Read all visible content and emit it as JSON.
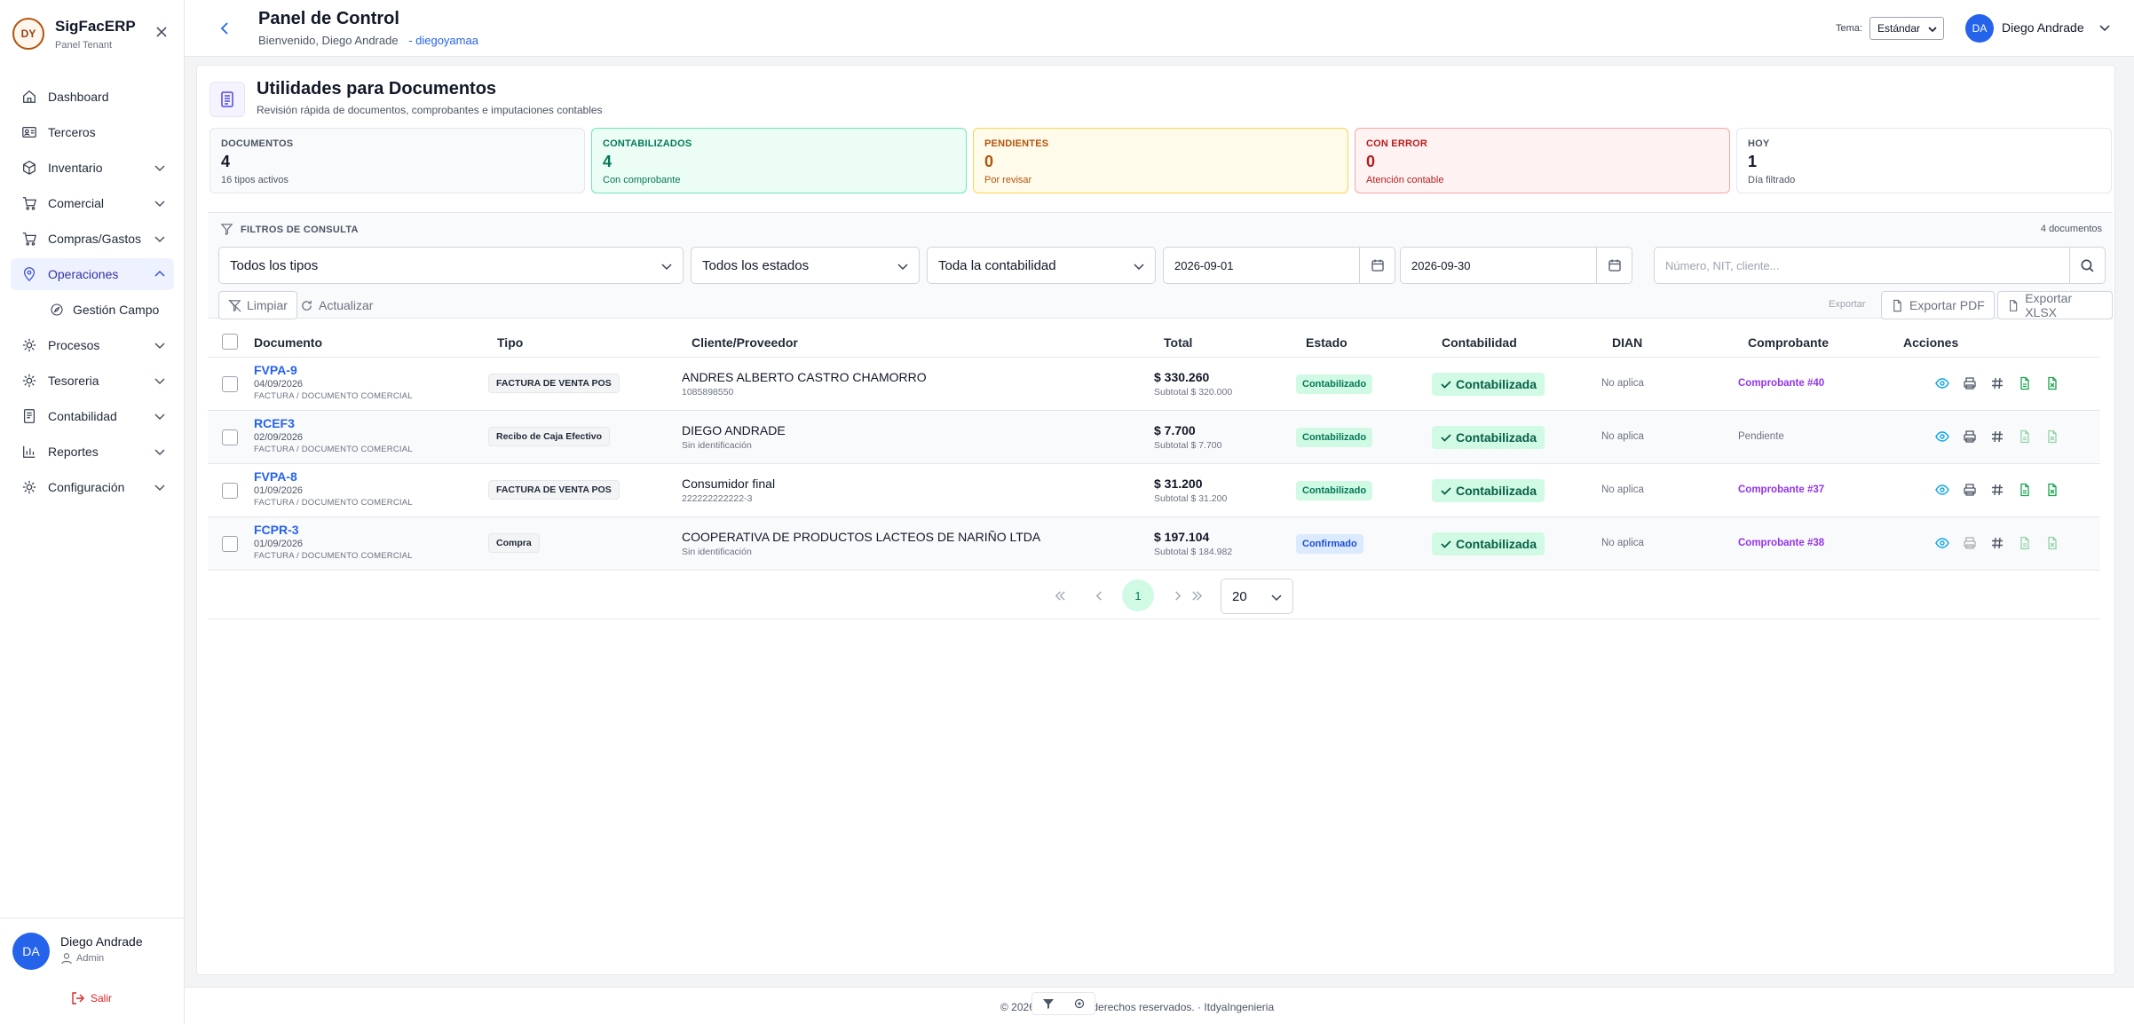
{
  "sidebar": {
    "brand": "SigFacERP",
    "brand_sub": "Panel Tenant",
    "logo_text": "DY",
    "items": [
      {
        "label": "Dashboard"
      },
      {
        "label": "Terceros"
      },
      {
        "label": "Inventario"
      },
      {
        "label": "Comercial"
      },
      {
        "label": "Compras/Gastos"
      },
      {
        "label": "Operaciones"
      },
      {
        "label": "Gestión Campo"
      },
      {
        "label": "Procesos"
      },
      {
        "label": "Tesoreria"
      },
      {
        "label": "Contabilidad"
      },
      {
        "label": "Reportes"
      },
      {
        "label": "Configuración"
      }
    ],
    "user": {
      "initials": "DA",
      "name": "Diego Andrade",
      "role": "Admin"
    },
    "logout": "Salir"
  },
  "header": {
    "title": "Panel de Control",
    "welcome": "Bienvenido, Diego Andrade",
    "username": "- diegoyamaa",
    "theme_label": "Tema:",
    "theme_value": "Estándar",
    "user_initials": "DA",
    "user_name": "Diego Andrade"
  },
  "page": {
    "title": "Utilidades para Documentos",
    "subtitle": "Revisión rápida de documentos, comprobantes e imputaciones contables"
  },
  "stats": [
    {
      "label": "DOCUMENTOS",
      "value": "4",
      "desc": "16 tipos activos"
    },
    {
      "label": "CONTABILIZADOS",
      "value": "4",
      "desc": "Con comprobante"
    },
    {
      "label": "PENDIENTES",
      "value": "0",
      "desc": "Por revisar"
    },
    {
      "label": "CON ERROR",
      "value": "0",
      "desc": "Atención contable"
    },
    {
      "label": "HOY",
      "value": "1",
      "desc": "Día filtrado"
    }
  ],
  "filters": {
    "heading": "FILTROS DE CONSULTA",
    "count": "4 documentos",
    "tipo": "Todos los tipos",
    "estado": "Todos los estados",
    "contabilidad": "Toda la contabilidad",
    "date_from": "2026-09-01",
    "date_to": "2026-09-30",
    "search_placeholder": "Número, NIT, cliente...",
    "clear": "Limpiar",
    "refresh": "Actualizar",
    "export_label": "Exportar",
    "export_pdf": "Exportar PDF",
    "export_xlsx": "Exportar XLSX"
  },
  "table": {
    "headers": [
      "Documento",
      "Tipo",
      "Cliente/Proveedor",
      "Total",
      "Estado",
      "Contabilidad",
      "DIAN",
      "Comprobante",
      "Acciones"
    ],
    "rows": [
      {
        "num": "FVPA-9",
        "date": "04/09/2026",
        "kind": "FACTURA / DOCUMENTO COMERCIAL",
        "tipo": "FACTURA DE VENTA POS",
        "cliente": "ANDRES ALBERTO CASTRO CHAMORRO",
        "cliente_id": "1085898550",
        "total": "$ 330.260",
        "subtotal": "Subtotal $ 320.000",
        "estado": "Contabilizado",
        "contabilidad": "Contabilizada",
        "dian": "No aplica",
        "comprobante": "Comprobante #40"
      },
      {
        "num": "RCEF3",
        "date": "02/09/2026",
        "kind": "FACTURA / DOCUMENTO COMERCIAL",
        "tipo": "Recibo de Caja Efectivo",
        "cliente": "DIEGO ANDRADE",
        "cliente_id": "Sin identificación",
        "total": "$ 7.700",
        "subtotal": "Subtotal $ 7.700",
        "estado": "Contabilizado",
        "contabilidad": "Contabilizada",
        "dian": "No aplica",
        "comprobante": "Pendiente"
      },
      {
        "num": "FVPA-8",
        "date": "01/09/2026",
        "kind": "FACTURA / DOCUMENTO COMERCIAL",
        "tipo": "FACTURA DE VENTA POS",
        "cliente": "Consumidor final",
        "cliente_id": "222222222222-3",
        "total": "$ 31.200",
        "subtotal": "Subtotal $ 31.200",
        "estado": "Contabilizado",
        "contabilidad": "Contabilizada",
        "dian": "No aplica",
        "comprobante": "Comprobante #37"
      },
      {
        "num": "FCPR-3",
        "date": "01/09/2026",
        "kind": "FACTURA / DOCUMENTO COMERCIAL",
        "tipo": "Compra",
        "cliente": "COOPERATIVA DE PRODUCTOS LACTEOS DE NARIÑO LTDA",
        "cliente_id": "Sin identificación",
        "total": "$ 197.104",
        "subtotal": "Subtotal $ 184.982",
        "estado": "Confirmado",
        "contabilidad": "Contabilizada",
        "dian": "No aplica",
        "comprobante": "Comprobante #38"
      }
    ]
  },
  "pager": {
    "current": "1",
    "page_size": "20"
  },
  "footer": {
    "text": "© 2026 · Todos los derechos reservados. · ItdyaIngenieria"
  },
  "colors": {
    "primary": "#2563eb",
    "success": "#047857",
    "warning": "#b45309",
    "danger": "#b91c1c",
    "purple": "#9333ea"
  }
}
